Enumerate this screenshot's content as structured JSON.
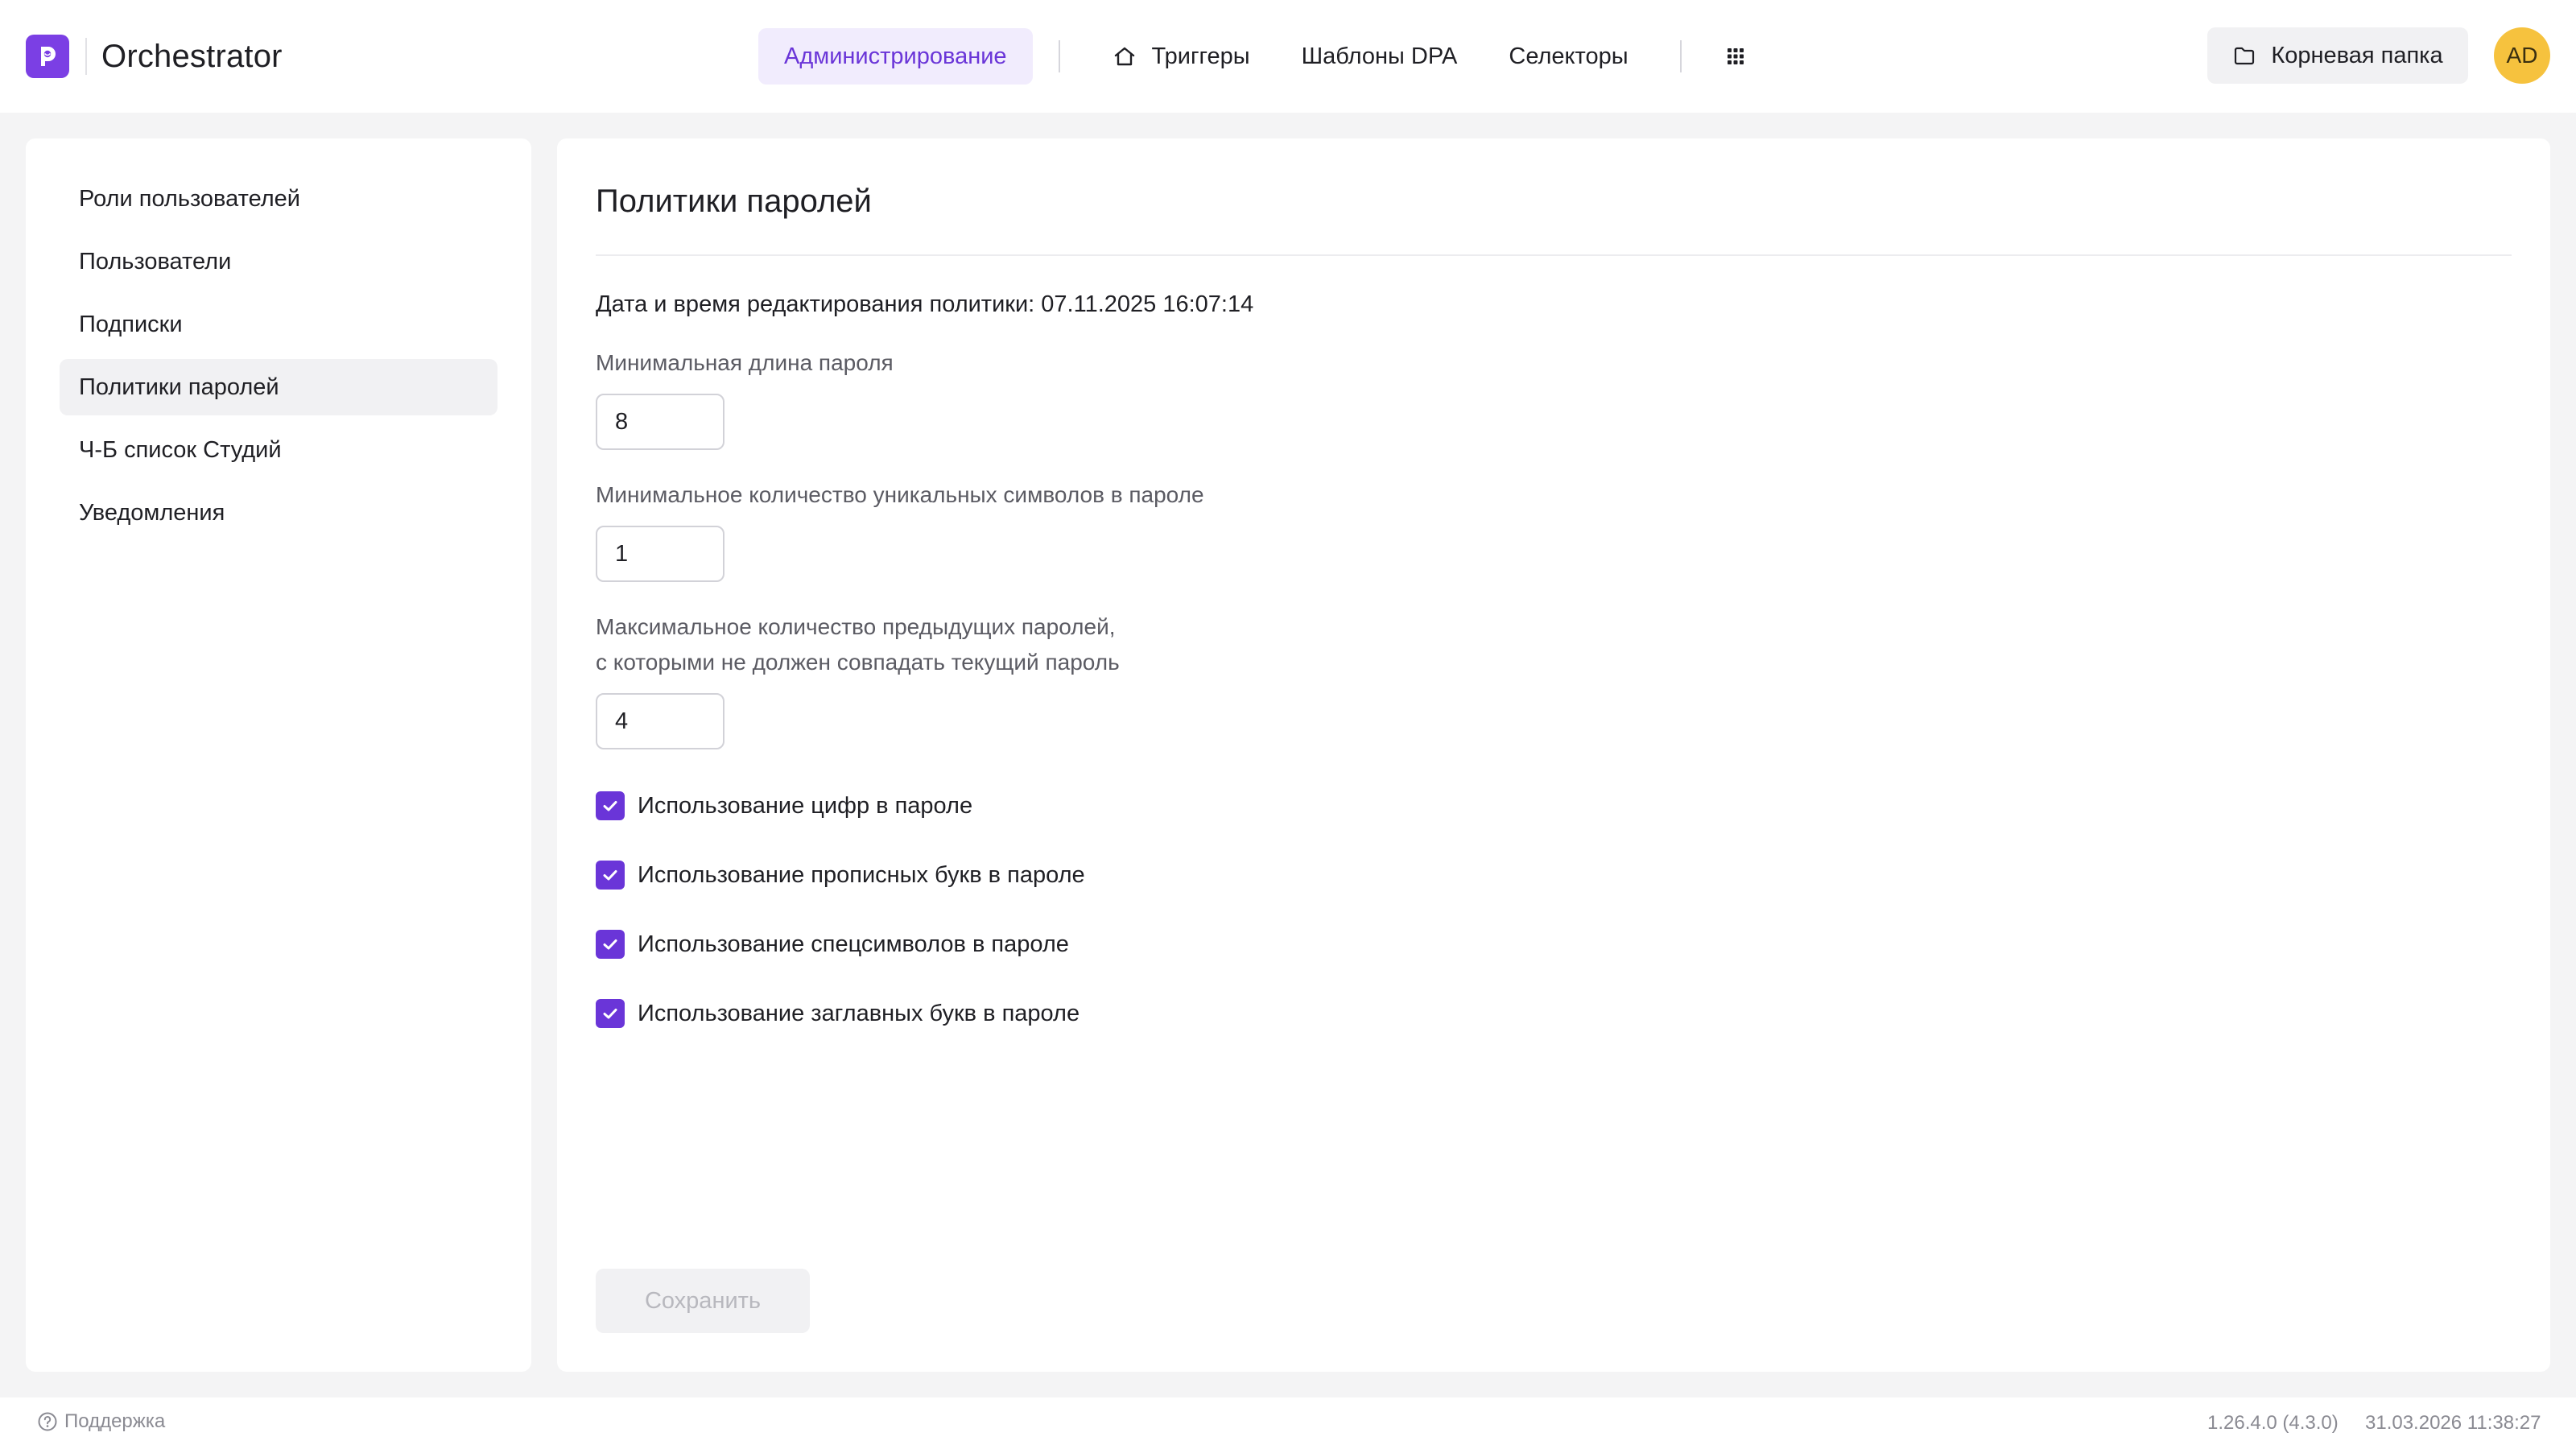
{
  "app": {
    "name": "Orchestrator"
  },
  "nav": {
    "admin": "Администрирование",
    "triggers": "Триггеры",
    "dpa_templates": "Шаблоны DPA",
    "selectors": "Селекторы"
  },
  "header": {
    "root_folder": "Корневая папка",
    "avatar_initials": "AD"
  },
  "sidebar": {
    "items": [
      {
        "label": "Роли пользователей"
      },
      {
        "label": "Пользователи"
      },
      {
        "label": "Подписки"
      },
      {
        "label": "Политики паролей",
        "active": true
      },
      {
        "label": "Ч-Б список Студий"
      },
      {
        "label": "Уведомления"
      }
    ]
  },
  "policy": {
    "title": "Политики паролей",
    "edited_label": "Дата и время редактирования политики: 07.11.2025 16:07:14",
    "fields": [
      {
        "label_lines": [
          "Минимальная длина пароля"
        ],
        "value": "8"
      },
      {
        "label_lines": [
          "Минимальное количество уникальных символов в пароле"
        ],
        "value": "1"
      },
      {
        "label_lines": [
          "Максимальное количество предыдущих паролей,",
          "с которыми не должен совпадать текущий пароль"
        ],
        "value": "4"
      }
    ],
    "checkboxes": [
      {
        "label": "Использование цифр в пароле",
        "checked": true
      },
      {
        "label": "Использование прописных букв в пароле",
        "checked": true
      },
      {
        "label": "Использование спецсимволов в пароле",
        "checked": true
      },
      {
        "label": "Использование заглавных букв в пароле",
        "checked": true
      }
    ],
    "save_label": "Сохранить"
  },
  "footer": {
    "support": "Поддержка",
    "version": "1.26.4.0 (4.3.0)",
    "datetime": "31.03.2026 11:38:27"
  },
  "colors": {
    "accent": "#6a35d8",
    "accent_bg": "#f1ecfd",
    "avatar": "#f6c23e",
    "logo": "#7b3fe4"
  },
  "icons": {
    "logo": "orchestrator-logo-icon",
    "triggers": "home-icon",
    "apps": "grid-icon",
    "folder": "folder-icon",
    "support": "help-circle-icon",
    "check": "checkmark-icon"
  }
}
